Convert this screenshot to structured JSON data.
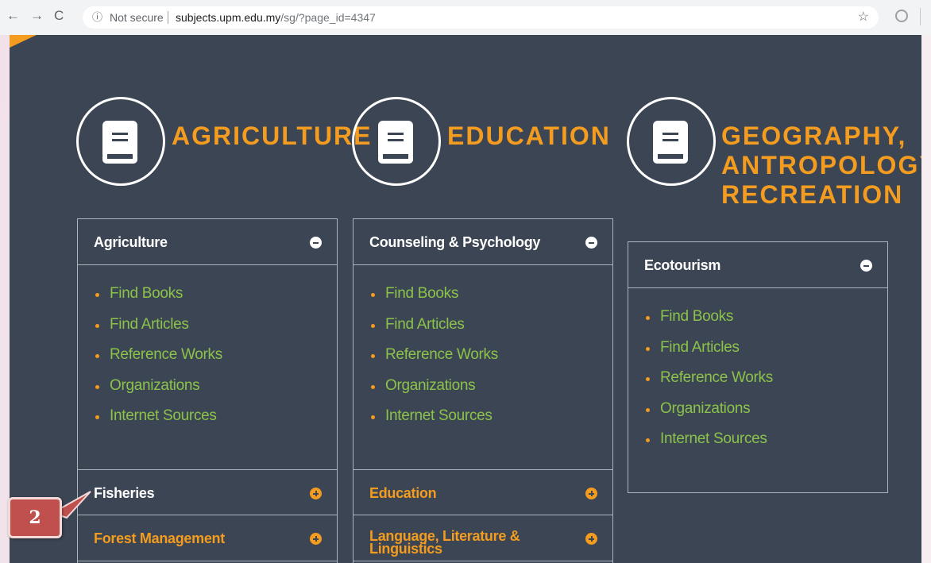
{
  "browser": {
    "url_host": "subjects.upm.edu.my",
    "url_path": "/sg/?page_id=4347",
    "security_text": "Not secure"
  },
  "columns": [
    {
      "heading": [
        "AGRICULTURE"
      ],
      "panels": [
        {
          "title": "Agriculture",
          "state": "expanded",
          "links": [
            "Find Books",
            "Find Articles",
            "Reference Works",
            "Organizations",
            "Internet Sources"
          ]
        },
        {
          "title": "Fisheries",
          "state": "collapsed"
        },
        {
          "title": "Forest Management",
          "state": "collapsed"
        }
      ]
    },
    {
      "heading": [
        "EDUCATION"
      ],
      "panels": [
        {
          "title": "Counseling & Psychology",
          "state": "expanded",
          "links": [
            "Find Books",
            "Find Articles",
            "Reference Works",
            "Organizations",
            "Internet Sources"
          ]
        },
        {
          "title": "Education",
          "state": "collapsed"
        },
        {
          "title": "Language, Literature & Linguistics",
          "state": "collapsed"
        }
      ]
    },
    {
      "heading": [
        "GEOGRAPHY,",
        "ANTROPOLOGY,",
        "RECREATION"
      ],
      "panels": [
        {
          "title": "Ecotourism",
          "state": "expanded",
          "links": [
            "Find Books",
            "Find Articles",
            "Reference Works",
            "Organizations",
            "Internet Sources"
          ]
        }
      ]
    }
  ],
  "callout": {
    "label": "2"
  },
  "colors": {
    "accent": "#f39c1f",
    "link": "#8bc34a",
    "background": "#3c4554"
  }
}
